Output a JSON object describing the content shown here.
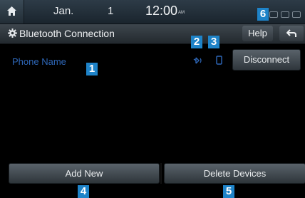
{
  "status_bar": {
    "date": "Jan.",
    "day": "1",
    "time": "12:00",
    "ampm": "AM"
  },
  "title_bar": {
    "title": "Bluetooth Connection",
    "help_label": "Help"
  },
  "device": {
    "phone_name": "Phone Name",
    "disconnect_label": "Disconnect"
  },
  "bottom": {
    "add_new_label": "Add New",
    "delete_label": "Delete Devices"
  },
  "callouts": [
    "1",
    "2",
    "3",
    "4",
    "5",
    "6"
  ],
  "colors": {
    "callout": "#1e83c8",
    "phone_name": "#2e67b8"
  },
  "icons": {
    "home": "home-icon",
    "settings": "gear-icon",
    "back": "back-arrow-icon",
    "bluetooth_audio": "bluetooth-audio-icon",
    "phone": "phone-icon"
  }
}
